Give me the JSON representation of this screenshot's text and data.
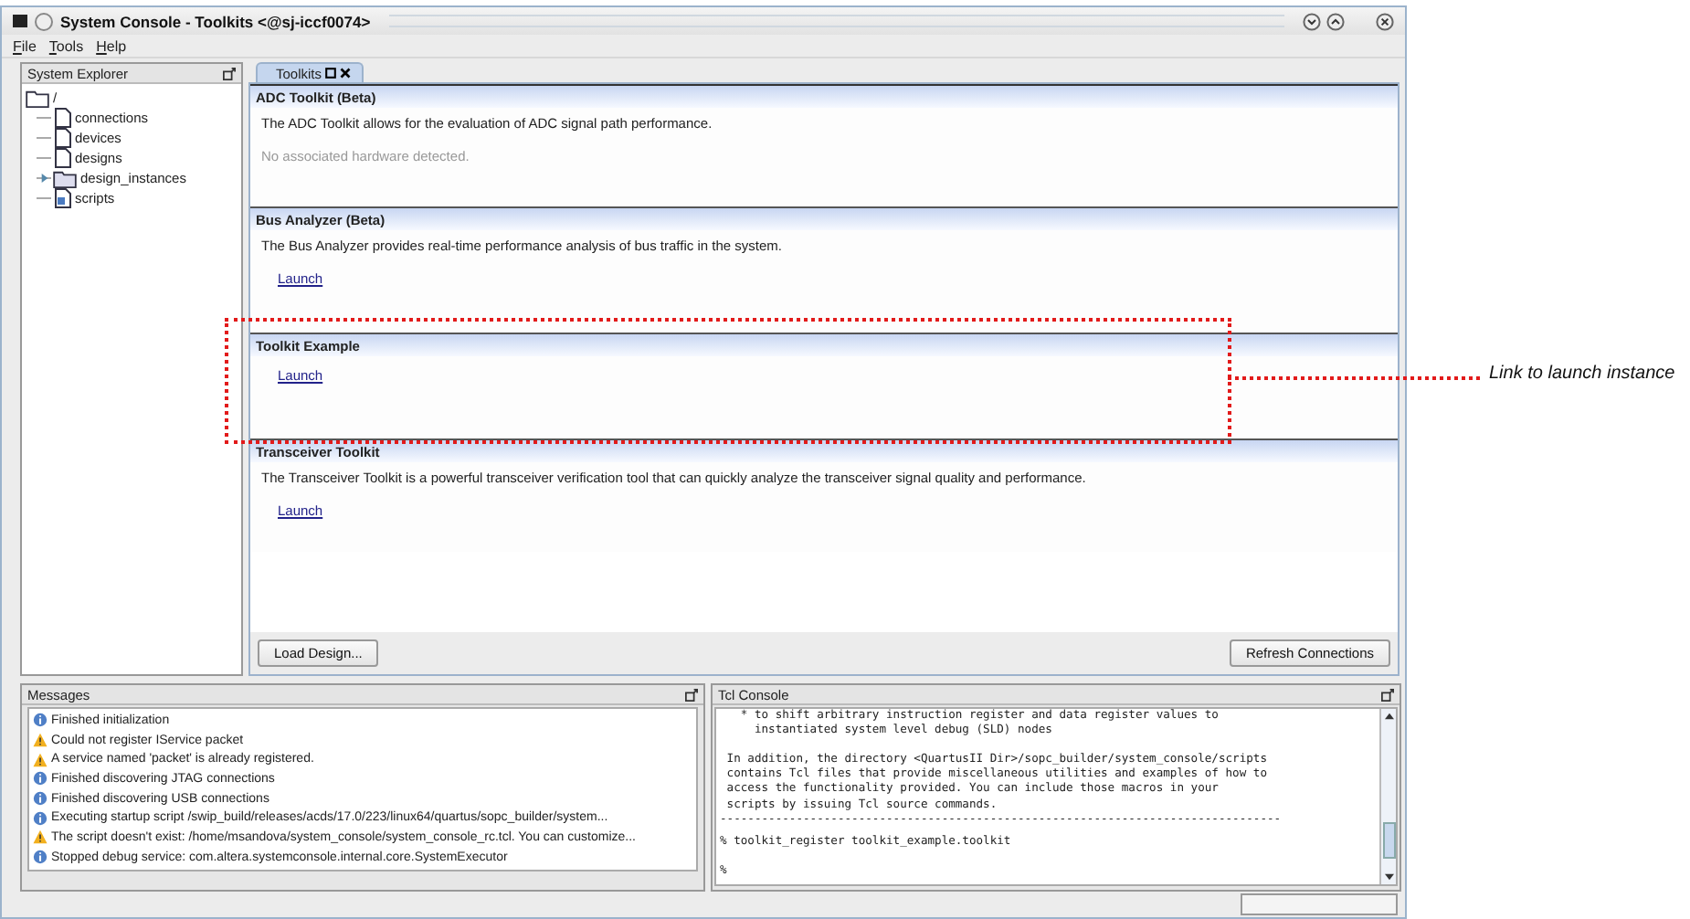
{
  "window": {
    "title": "System Console - Toolkits <@sj-iccf0074>"
  },
  "menu": [
    "File",
    "Tools",
    "Help"
  ],
  "explorer": {
    "title": "System Explorer",
    "tree": [
      {
        "label": "/",
        "kind": "folder",
        "expanded": true,
        "children": [
          {
            "label": "connections",
            "kind": "file"
          },
          {
            "label": "devices",
            "kind": "file"
          },
          {
            "label": "designs",
            "kind": "file"
          },
          {
            "label": "design_instances",
            "kind": "folder",
            "expanded": false
          },
          {
            "label": "scripts",
            "kind": "script"
          }
        ]
      }
    ]
  },
  "tabs": [
    {
      "label": "Toolkits",
      "selected": true
    }
  ],
  "toolkits": [
    {
      "title": "ADC Toolkit (Beta)",
      "description": "The ADC Toolkit allows for the evaluation of ADC signal path performance.",
      "status": "No associated hardware detected."
    },
    {
      "title": "Bus Analyzer (Beta)",
      "description": "The Bus Analyzer provides real-time performance analysis of bus traffic in the system.",
      "link": "Launch"
    },
    {
      "title": "Toolkit Example",
      "link": "Launch"
    },
    {
      "title": "Transceiver Toolkit",
      "description": "The Transceiver Toolkit is a powerful transceiver verification tool that can quickly analyze the transceiver signal quality and performance.",
      "link": "Launch"
    }
  ],
  "buttons": [
    "Load Design...",
    "Refresh Connections"
  ],
  "messages": {
    "title": "Messages",
    "items": [
      {
        "kind": "info",
        "text": "Finished initialization"
      },
      {
        "kind": "warning",
        "text": "Could not register IService packet"
      },
      {
        "kind": "warning",
        "text": "A service named 'packet' is already registered."
      },
      {
        "kind": "info",
        "text": "Finished discovering JTAG connections"
      },
      {
        "kind": "info",
        "text": "Finished discovering USB connections"
      },
      {
        "kind": "info",
        "text": "Executing startup script /swip_build/releases/acds/17.0/223/linux64/quartus/sopc_builder/system..."
      },
      {
        "kind": "warning",
        "text": "The script doesn't exist: /home/msandova/system_console/system_console_rc.tcl. You can customize..."
      },
      {
        "kind": "info",
        "text": "Stopped debug service: com.altera.systemconsole.internal.core.SystemExecutor"
      }
    ]
  },
  "tcl_console": {
    "title": "Tcl Console",
    "blocks": [
      [
        "   * to shift arbitrary instruction register and data register values to",
        "     instantiated system level debug (SLD) nodes"
      ],
      [
        " In addition, the directory <QuartusII Dir>/sopc_builder/system_console/scripts",
        " contains Tcl files that provide miscellaneous utilities and examples of how to",
        " access the functionality provided. You can include those macros in your",
        " scripts by issuing Tcl source commands.",
        "---------------------------------------------------------------------------------"
      ],
      [
        "% toolkit_register toolkit_example.toolkit"
      ],
      [
        "%"
      ]
    ]
  },
  "callout": {
    "label": "Link to launch instance"
  }
}
